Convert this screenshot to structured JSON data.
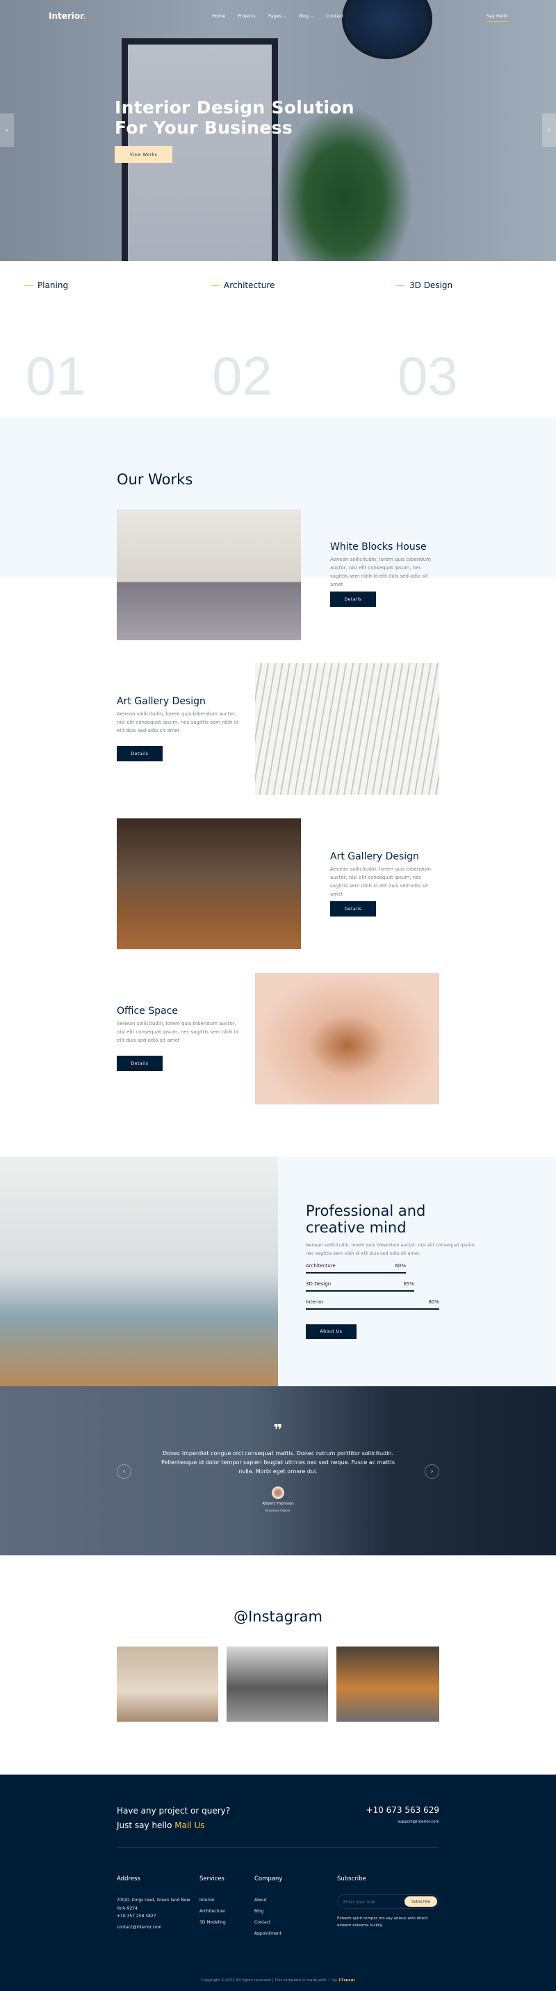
{
  "header": {
    "logo": "Interior",
    "logo_dot": ".",
    "nav": [
      "Home",
      "Projects",
      "Pages",
      "Blog",
      "Contact"
    ],
    "say_hello": "Say Hello"
  },
  "hero": {
    "title_line1": "Interior Design Solution",
    "title_line2": "For Your Business",
    "button": "View Works",
    "prev": "‹",
    "next": "›"
  },
  "features": [
    {
      "label": "Planing",
      "number": "01"
    },
    {
      "label": "Architecture",
      "number": "02"
    },
    {
      "label": "3D Design",
      "number": "03"
    }
  ],
  "works": {
    "title": "Our Works",
    "items": [
      {
        "title": "White Blocks House",
        "text": "Aenean sollicitudin, lorem quis bibendum auctor, nisi elit consequat ipsum, nec sagittis sem nibh id elit duis sed odio sit amet",
        "button": "Details"
      },
      {
        "title": "Art Gallery Design",
        "text": "Aenean sollicitudin, lorem quis bibendum auctor, nisi elit consequat ipsum, nec sagittis sem nibh id elit duis sed odio sit amet",
        "button": "Details"
      },
      {
        "title": "Art Gallery Design",
        "text": "Aenean sollicitudin, lorem quis bibendum auctor, nisi elit consequat ipsum, nec sagittis sem nibh id elit duis sed odio sit amet",
        "button": "Details"
      },
      {
        "title": "Office Space",
        "text": "Aenean sollicitudin, lorem quis bibendum auctor, nisi elit consequat ipsum, nec sagittis sem nibh id elit duis sed odio sit amet",
        "button": "Details"
      }
    ]
  },
  "about": {
    "title_line1": "Professional and",
    "title_line2": "creative mind",
    "text": "Aenean sollicitudin, lorem quis bibendum auctor, nisi elit consequat ipsum, nec sagittis sem nibh id elit duis sed odio sit amet.",
    "skills": [
      {
        "label": "Architecture",
        "value": 60,
        "display": "60%"
      },
      {
        "label": "3D Design",
        "value": 65,
        "display": "65%"
      },
      {
        "label": "Interior",
        "value": 80,
        "display": "80%"
      }
    ],
    "button": "About Us"
  },
  "testimonial": {
    "quote_mark": "❞",
    "text": "Donec imperdiet congue orci consequat mattis. Donec rutrum porttitor sollicitudin. Pellentesque id dolor tempor sapien feugiat ultrices nec sed neque. Fusce ac mattis nulla. Morbi eget ornare dui.",
    "name": "Robert Thomson",
    "role": "Business Owner",
    "prev": "‹",
    "next": "›"
  },
  "instagram": {
    "title": "@Instagram"
  },
  "footer": {
    "cta_line1": "Have any project or query?",
    "cta_line2": "Just say hello ",
    "cta_link": "Mail Us",
    "phone": "+10 673 563 629",
    "email": "support@interior.com",
    "address": {
      "title": "Address",
      "lines": [
        "700/D, Kings road, Green land New York-9274",
        "+10 357 258 3827",
        "contact@interior.com"
      ]
    },
    "services": {
      "title": "Services",
      "items": [
        "Interior",
        "Architecture",
        "3D Modeling"
      ]
    },
    "company": {
      "title": "Company",
      "items": [
        "About",
        "Blog",
        "Contact",
        "Appointment"
      ]
    },
    "subscribe": {
      "title": "Subscribe",
      "placeholder": "Enter your mail",
      "button": "Subscribe",
      "text": "Esteem spirit temper too say adieus who direct esteem esteems luckily."
    },
    "copyright": "Copyright ©2022 All rights reserved | This template is made with ♡ by ",
    "credit": "17sucai"
  },
  "colors": {
    "navy": "#001d38",
    "accent": "#fdc449",
    "light_bg": "#f3f8fd",
    "button_cream": "#fee7c0"
  }
}
